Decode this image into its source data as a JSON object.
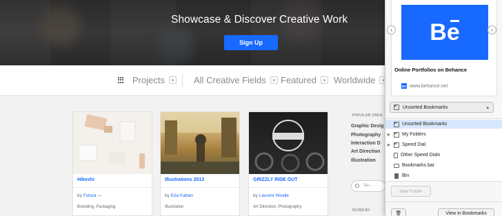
{
  "hero": {
    "title": "Showcase & Discover Creative Work",
    "signup_label": "Sign Up"
  },
  "nav": {
    "projects": "Projects",
    "creative_fields": "All Creative Fields",
    "featured": "Featured",
    "worldwide": "Worldwide"
  },
  "cards": [
    {
      "title": "Hikeshi",
      "by": "by",
      "author": "Futura",
      "author_suffix": " —",
      "fields": "Branding, Packaging"
    },
    {
      "title": "Illustrations 2013",
      "by": "by",
      "author": "Eda Kaban",
      "author_suffix": "",
      "fields": "Illustration"
    },
    {
      "title": "GRIZZLY RIDE OUT",
      "by": "by",
      "author": "Laurent Nivalle",
      "author_suffix": "",
      "fields": "Art Direction, Photography"
    }
  ],
  "sidebar": {
    "label": "POPULAR CREA",
    "links": [
      "Graphic Desig",
      "Photography",
      "Interaction D",
      "Art Direction",
      "Illustration"
    ],
    "search_placeholder": "Se...",
    "filter_label": "FILTER BY"
  },
  "popup": {
    "tile_letters": "Be",
    "page_title": "Online Portfolios on Behance",
    "url": "www.behance.net",
    "favicon_text": "Bē",
    "prev_arrow": "‹",
    "next_arrow": "›",
    "folder_selected": "Unsorted Bookmarks",
    "folder_chevron": "▴",
    "tree": [
      "Unsorted Bookmarks",
      "My Folders",
      "Speed Dial",
      "Other Speed Dials",
      "Bookmarks bar",
      "Bin"
    ],
    "new_folder": "New Folder",
    "trash_icon": "🗑",
    "view_in_bookmarks": "View in Bookmarks"
  },
  "colors": {
    "accent": "#1769ff",
    "hero_bg": "#2e2e2e",
    "selection": "#d8e7fb"
  }
}
